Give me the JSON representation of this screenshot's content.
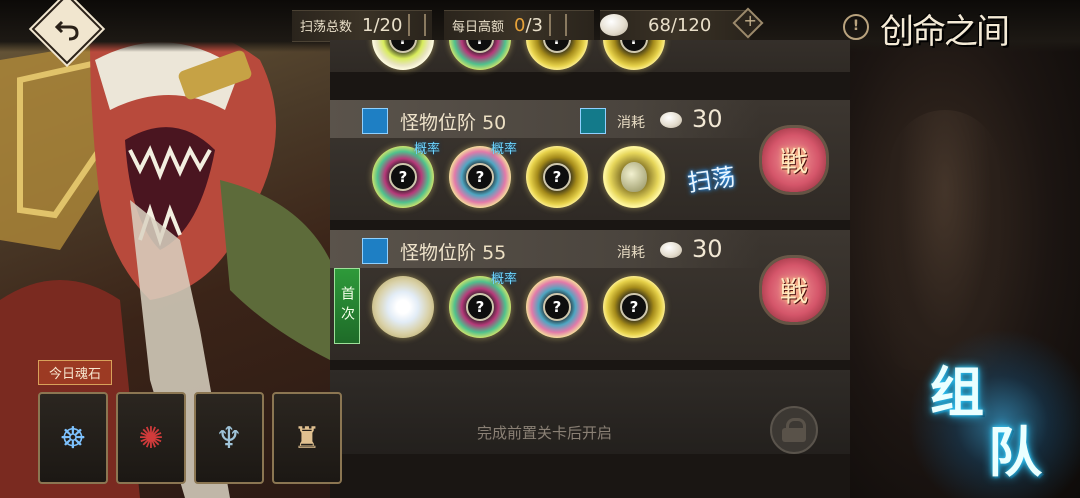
{
  "header": {
    "title": "创命之间",
    "sweep_label": "扫荡总数",
    "sweep_value": "1/20",
    "daily_label": "每日高额",
    "daily_current": "0",
    "daily_max": "/3",
    "currency_value": "68/120",
    "info_icon": "!"
  },
  "stages": [
    {
      "name": "怪物位阶",
      "level": "50",
      "cost_label": "消耗",
      "cost": "30",
      "battle_label": "戦",
      "sweep_label": "扫荡",
      "drop_tag": "概率"
    },
    {
      "name": "怪物位阶",
      "level": "55",
      "cost_label": "消耗",
      "cost": "30",
      "battle_label": "戦",
      "first_label": "首次",
      "drop_tag": "概率"
    }
  ],
  "locked": {
    "message": "完成前置关卡后开启"
  },
  "soul": {
    "label": "今日魂石"
  },
  "team": {
    "char1": "组",
    "char2": "队"
  },
  "colors": {
    "accent_gold": "#e6d24a",
    "battle_pink": "#d5566a",
    "team_blue": "#2ec9ff",
    "first_green": "#2e9a3a"
  }
}
